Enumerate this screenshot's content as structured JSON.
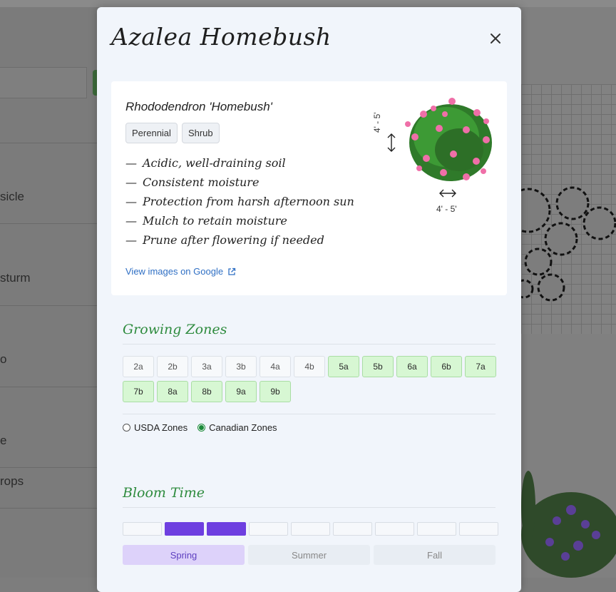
{
  "background": {
    "sidebar_labels": [
      "sicle",
      "sturm",
      "o",
      "e",
      "rops"
    ]
  },
  "modal": {
    "title": "Azalea Homebush",
    "close_icon": "close-icon"
  },
  "plant": {
    "scientific_name": "Rhododendron 'Homebush'",
    "tags": [
      "Perennial",
      "Shrub"
    ],
    "care": [
      "Acidic, well-draining soil",
      "Consistent moisture",
      "Protection from harsh afternoon sun",
      "Mulch to retain moisture",
      "Prune after flowering if needed"
    ],
    "google_link": "View images on Google",
    "height": "4' - 5'",
    "width": "4' - 5'"
  },
  "growing_zones": {
    "title": "Growing Zones",
    "zones": [
      {
        "label": "2a",
        "active": false
      },
      {
        "label": "2b",
        "active": false
      },
      {
        "label": "3a",
        "active": false
      },
      {
        "label": "3b",
        "active": false
      },
      {
        "label": "4a",
        "active": false
      },
      {
        "label": "4b",
        "active": false
      },
      {
        "label": "5a",
        "active": true
      },
      {
        "label": "5b",
        "active": true
      },
      {
        "label": "6a",
        "active": true
      },
      {
        "label": "6b",
        "active": true
      },
      {
        "label": "7a",
        "active": true
      },
      {
        "label": "7b",
        "active": true
      },
      {
        "label": "8a",
        "active": true
      },
      {
        "label": "8b",
        "active": true
      },
      {
        "label": "9a",
        "active": true
      },
      {
        "label": "9b",
        "active": true
      }
    ],
    "options": [
      {
        "label": "USDA Zones",
        "checked": false
      },
      {
        "label": "Canadian Zones",
        "checked": true
      }
    ]
  },
  "bloom_time": {
    "title": "Bloom Time",
    "segments": [
      false,
      true,
      true,
      false,
      false,
      false,
      false,
      false,
      false
    ],
    "seasons": [
      {
        "label": "Spring",
        "active": true
      },
      {
        "label": "Summer",
        "active": false
      },
      {
        "label": "Fall",
        "active": false
      }
    ],
    "accent": "#6e3fe0"
  }
}
